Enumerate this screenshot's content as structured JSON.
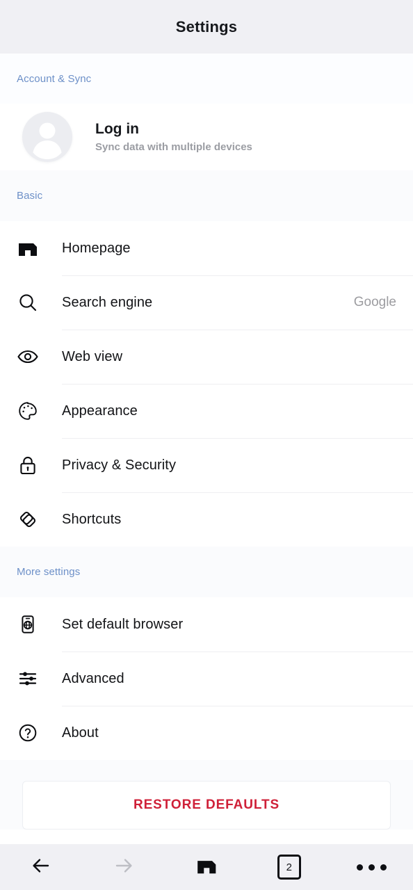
{
  "header": {
    "title": "Settings"
  },
  "sections": [
    {
      "id": "account",
      "label": "Account & Sync"
    },
    {
      "id": "basic",
      "label": "Basic"
    },
    {
      "id": "more",
      "label": "More settings"
    }
  ],
  "account": {
    "avatar_icon": "user-avatar-icon",
    "title": "Log in",
    "subtitle": "Sync data with multiple devices"
  },
  "basic_items": [
    {
      "label": "Homepage",
      "value": "",
      "icon": "maxthon-logo-icon"
    },
    {
      "label": "Search engine",
      "value": "Google",
      "icon": "search-icon"
    },
    {
      "label": "Web view",
      "value": "",
      "icon": "eye-icon"
    },
    {
      "label": "Appearance",
      "value": "",
      "icon": "palette-icon"
    },
    {
      "label": "Privacy & Security",
      "value": "",
      "icon": "lock-icon"
    },
    {
      "label": "Shortcuts",
      "value": "",
      "icon": "shortcuts-icon"
    }
  ],
  "more_items": [
    {
      "label": "Set default browser",
      "value": "",
      "icon": "phone-globe-icon"
    },
    {
      "label": "Advanced",
      "value": "",
      "icon": "sliders-icon"
    },
    {
      "label": "About",
      "value": "",
      "icon": "question-circle-icon"
    }
  ],
  "restore": {
    "label": "RESTORE DEFAULTS",
    "color": "#cf2038"
  },
  "navbar": {
    "back": "back-arrow-icon",
    "forward": "forward-arrow-icon",
    "home": "maxthon-home-icon",
    "tabs_count": "2",
    "menu": "more-menu-icon"
  },
  "colors": {
    "header_bg": "#f0f0f4",
    "section_label": "#6d90c8",
    "row_label": "#121316",
    "value_text": "#9c9ca0",
    "restore_red": "#cf2038",
    "divider": "#eeeef1"
  }
}
